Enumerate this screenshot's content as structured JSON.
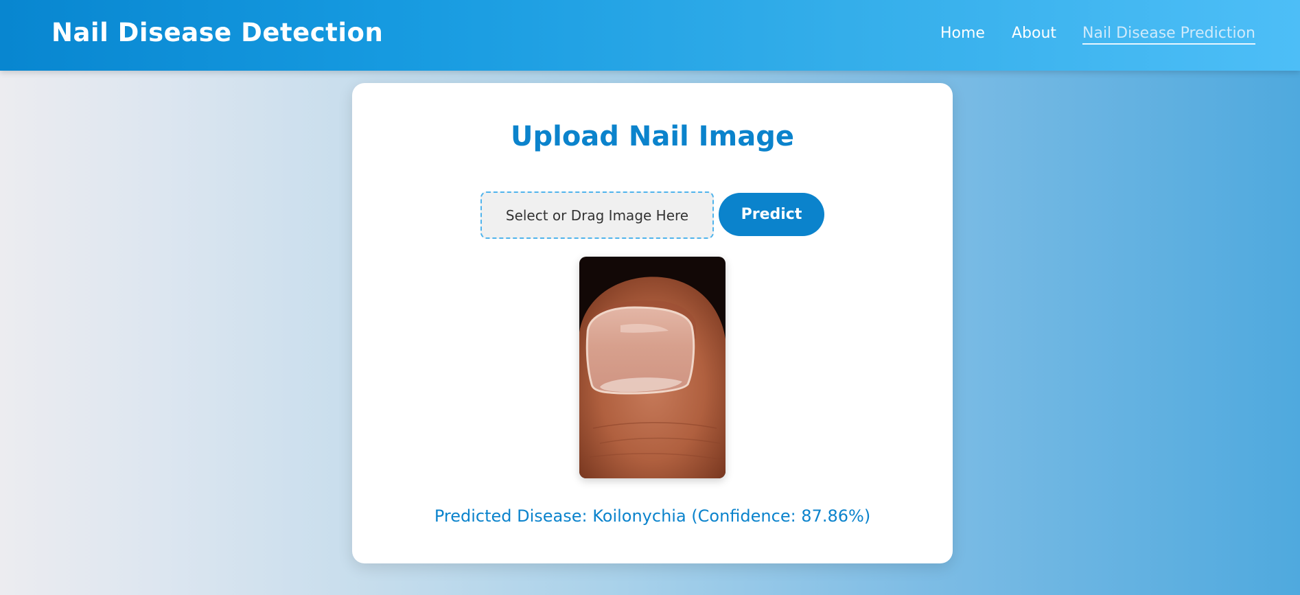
{
  "header": {
    "brand": "Nail Disease Detection",
    "nav": {
      "home": "Home",
      "about": "About",
      "prediction": "Nail Disease Prediction"
    }
  },
  "main": {
    "title": "Upload Nail Image",
    "upload_placeholder": "Select or Drag Image Here",
    "predict_label": "Predict",
    "result_text": "Predicted Disease: Koilonychia (Confidence: 87.86%)"
  },
  "colors": {
    "accent": "#0b83cc",
    "header_start": "#0886d0",
    "header_end": "#4dbef7",
    "dropzone_border": "#4eb3ec"
  }
}
